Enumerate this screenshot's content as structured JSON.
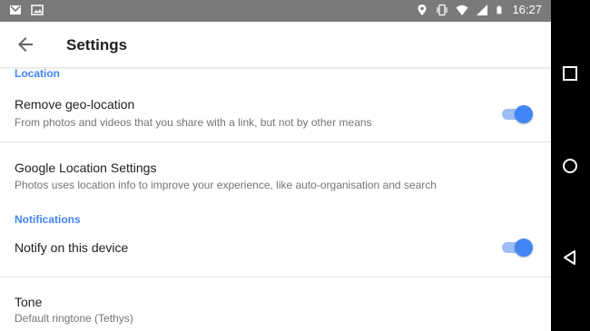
{
  "statusbar": {
    "left_icons": [
      "gmail-icon",
      "image-icon"
    ],
    "right_icons": [
      "location-icon",
      "vibrate-icon",
      "wifi-icon",
      "signal-icon",
      "battery-icon"
    ],
    "time": "16:27"
  },
  "appbar": {
    "title": "Settings",
    "back_icon": "arrow-back-icon"
  },
  "sections": [
    {
      "header": "Location",
      "items": [
        {
          "title": "Remove geo-location",
          "subtitle": "From photos and videos that you share with a link, but not by other means",
          "toggle": true
        },
        {
          "title": "Google Location Settings",
          "subtitle": "Photos uses location info to improve your experience, like auto-organisation and search"
        }
      ]
    },
    {
      "header": "Notifications",
      "items": [
        {
          "title": "Notify on this device",
          "toggle": true
        },
        {
          "title": "Tone",
          "subtitle": "Default ringtone (Tethys)"
        }
      ]
    }
  ],
  "navbar": {
    "buttons": [
      "recents-button",
      "home-button",
      "back-button"
    ]
  },
  "colors": {
    "accent": "#4285f4",
    "statusbar": "#7a7a7a",
    "navbar": "#000000"
  }
}
